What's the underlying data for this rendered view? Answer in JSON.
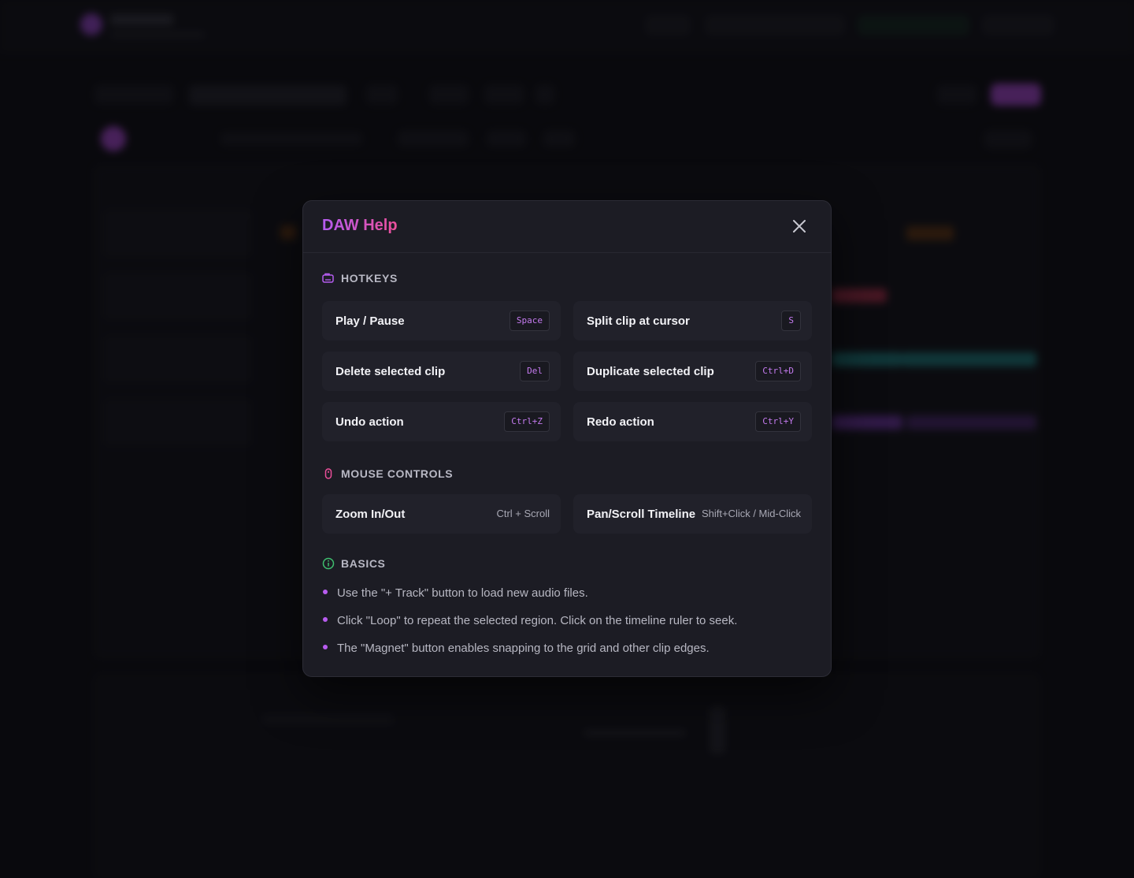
{
  "modal": {
    "title": "DAW Help",
    "close_label": "×",
    "colors": {
      "accent_purple": "#b55cf0",
      "accent_pink": "#ec4f9a",
      "basics_green": "#3fbf6f"
    },
    "sections": {
      "hotkeys": {
        "title": "HOTKEYS",
        "icon": "keyboard-icon",
        "items": [
          {
            "label": "Play / Pause",
            "key": "Space"
          },
          {
            "label": "Split clip at cursor",
            "key": "S"
          },
          {
            "label": "Delete selected clip",
            "key": "Del"
          },
          {
            "label": "Duplicate selected clip",
            "key": "Ctrl+D"
          },
          {
            "label": "Undo action",
            "key": "Ctrl+Z"
          },
          {
            "label": "Redo action",
            "key": "Ctrl+Y"
          }
        ]
      },
      "mouse": {
        "title": "MOUSE CONTROLS",
        "icon": "mouse-icon",
        "items": [
          {
            "label": "Zoom In/Out",
            "key": "Ctrl + Scroll"
          },
          {
            "label": "Pan/Scroll Timeline",
            "key": "Shift+Click / Mid-Click"
          }
        ]
      },
      "basics": {
        "title": "BASICS",
        "icon": "info-icon",
        "items": [
          "Use the \"+ Track\" button to load new audio files.",
          "Click \"Loop\" to repeat the selected region. Click on the timeline ruler to seek.",
          "The \"Magnet\" button enables snapping to the grid and other clip edges."
        ]
      }
    }
  }
}
